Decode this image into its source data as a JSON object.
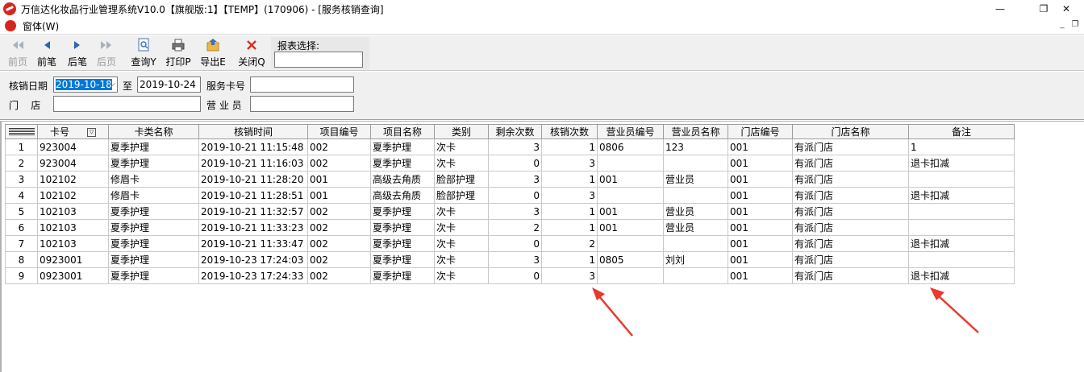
{
  "window": {
    "title": "万信达化妆品行业管理系统V10.0【旗舰版:1】【TEMP】(170906) - [服务核销查询]",
    "minimize_glyph": "—",
    "restore_glyph": "❐",
    "close_glyph": "✕"
  },
  "menubar": {
    "items": [
      {
        "label": "窗体(W)"
      }
    ],
    "mdi_minimize": "_",
    "mdi_restore": "❐"
  },
  "toolbar": {
    "buttons": [
      {
        "label": "前页",
        "icon": "double-left-arrow-icon",
        "enabled": false
      },
      {
        "label": "前笔",
        "icon": "left-arrow-icon",
        "enabled": true
      },
      {
        "label": "后笔",
        "icon": "right-arrow-icon",
        "enabled": true
      },
      {
        "label": "后页",
        "icon": "double-right-arrow-icon",
        "enabled": false
      },
      {
        "label": "查询Y",
        "icon": "query-icon",
        "enabled": true
      },
      {
        "label": "打印P",
        "icon": "printer-icon",
        "enabled": true
      },
      {
        "label": "导出E",
        "icon": "export-icon",
        "enabled": true
      },
      {
        "label": "关闭Q",
        "icon": "close-icon",
        "enabled": true
      }
    ],
    "report_select_label": "报表选择:",
    "report_select_value": ""
  },
  "filter": {
    "date_label": "核销日期",
    "date_from": "2019-10-18",
    "to_label": "至",
    "date_to": "2019-10-24",
    "card_label": "服务卡号",
    "card_value": "",
    "store_label": "门    店",
    "store_value": "",
    "staff_label": "营 业 员",
    "staff_value": ""
  },
  "grid": {
    "columns": [
      "卡号",
      "卡类名称",
      "核销时间",
      "项目编号",
      "项目名称",
      "类别",
      "剩余次数",
      "核销次数",
      "营业员编号",
      "营业员名称",
      "门店编号",
      "门店名称",
      "备注"
    ],
    "rows": [
      {
        "n": "1",
        "cells": [
          "923004",
          "夏季护理",
          "2019-10-21 11:15:48",
          "002",
          "夏季护理",
          "次卡",
          "3",
          "1",
          "0806",
          "123",
          "001",
          "有派门店",
          "1"
        ]
      },
      {
        "n": "2",
        "cells": [
          "923004",
          "夏季护理",
          "2019-10-21 11:16:03",
          "002",
          "夏季护理",
          "次卡",
          "0",
          "3",
          "",
          "",
          "001",
          "有派门店",
          "退卡扣减"
        ]
      },
      {
        "n": "3",
        "cells": [
          "102102",
          "修眉卡",
          "2019-10-21 11:28:20",
          "001",
          "高级去角质",
          "脸部护理",
          "3",
          "1",
          "001",
          "营业员",
          "001",
          "有派门店",
          ""
        ]
      },
      {
        "n": "4",
        "cells": [
          "102102",
          "修眉卡",
          "2019-10-21 11:28:51",
          "001",
          "高级去角质",
          "脸部护理",
          "0",
          "3",
          "",
          "",
          "001",
          "有派门店",
          "退卡扣减"
        ]
      },
      {
        "n": "5",
        "cells": [
          "102103",
          "夏季护理",
          "2019-10-21 11:32:57",
          "002",
          "夏季护理",
          "次卡",
          "3",
          "1",
          "001",
          "营业员",
          "001",
          "有派门店",
          ""
        ]
      },
      {
        "n": "6",
        "cells": [
          "102103",
          "夏季护理",
          "2019-10-21 11:33:23",
          "002",
          "夏季护理",
          "次卡",
          "2",
          "1",
          "001",
          "营业员",
          "001",
          "有派门店",
          ""
        ]
      },
      {
        "n": "7",
        "cells": [
          "102103",
          "夏季护理",
          "2019-10-21 11:33:47",
          "002",
          "夏季护理",
          "次卡",
          "0",
          "2",
          "",
          "",
          "001",
          "有派门店",
          "退卡扣减"
        ]
      },
      {
        "n": "8",
        "cells": [
          "0923001",
          "夏季护理",
          "2019-10-23 17:24:03",
          "002",
          "夏季护理",
          "次卡",
          "3",
          "1",
          "0805",
          "刘刘",
          "001",
          "有派门店",
          ""
        ]
      },
      {
        "n": "9",
        "cells": [
          "0923001",
          "夏季护理",
          "2019-10-23 17:24:33",
          "002",
          "夏季护理",
          "次卡",
          "0",
          "3",
          "",
          "",
          "001",
          "有派门店",
          "退卡扣减"
        ]
      }
    ]
  },
  "annotation_color": "#e8392f"
}
